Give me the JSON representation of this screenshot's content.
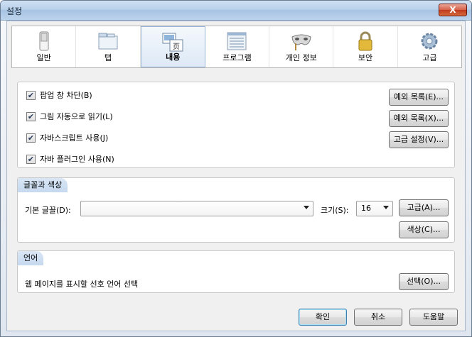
{
  "window": {
    "title": "설정",
    "close_label": "X"
  },
  "toolbar": [
    {
      "label": "일반",
      "icon": "switch-icon"
    },
    {
      "label": "탭",
      "icon": "tabs-icon"
    },
    {
      "label": "내용",
      "icon": "content-icon",
      "selected": true
    },
    {
      "label": "프로그램",
      "icon": "applications-icon"
    },
    {
      "label": "개인 정보",
      "icon": "mask-icon"
    },
    {
      "label": "보안",
      "icon": "lock-icon"
    },
    {
      "label": "고급",
      "icon": "gear-icon"
    }
  ],
  "content": {
    "popup": {
      "label": "팝업 창 차단(B)",
      "checked": true,
      "button": "예외 목록(E)..."
    },
    "images": {
      "label": "그림 자동으로 읽기(L)",
      "checked": true,
      "button": "예외 목록(X)..."
    },
    "javascript": {
      "label": "자바스크립트 사용(J)",
      "checked": true,
      "button": "고급 설정(V)..."
    },
    "java": {
      "label": "자바 플러그인 사용(N)",
      "checked": true
    }
  },
  "fonts": {
    "section_title": "글꼴과 색상",
    "default_font_label": "기본 글꼴(D):",
    "default_font_value": "",
    "size_label": "크기(S):",
    "size_value": "16",
    "advanced_button": "고급(A)...",
    "colors_button": "색상(C)..."
  },
  "languages": {
    "section_title": "언어",
    "description": "웹 페이지를 표시할 선호 언어 선택",
    "choose_button": "선택(O)..."
  },
  "footer": {
    "ok": "확인",
    "cancel": "취소",
    "help": "도움말"
  }
}
